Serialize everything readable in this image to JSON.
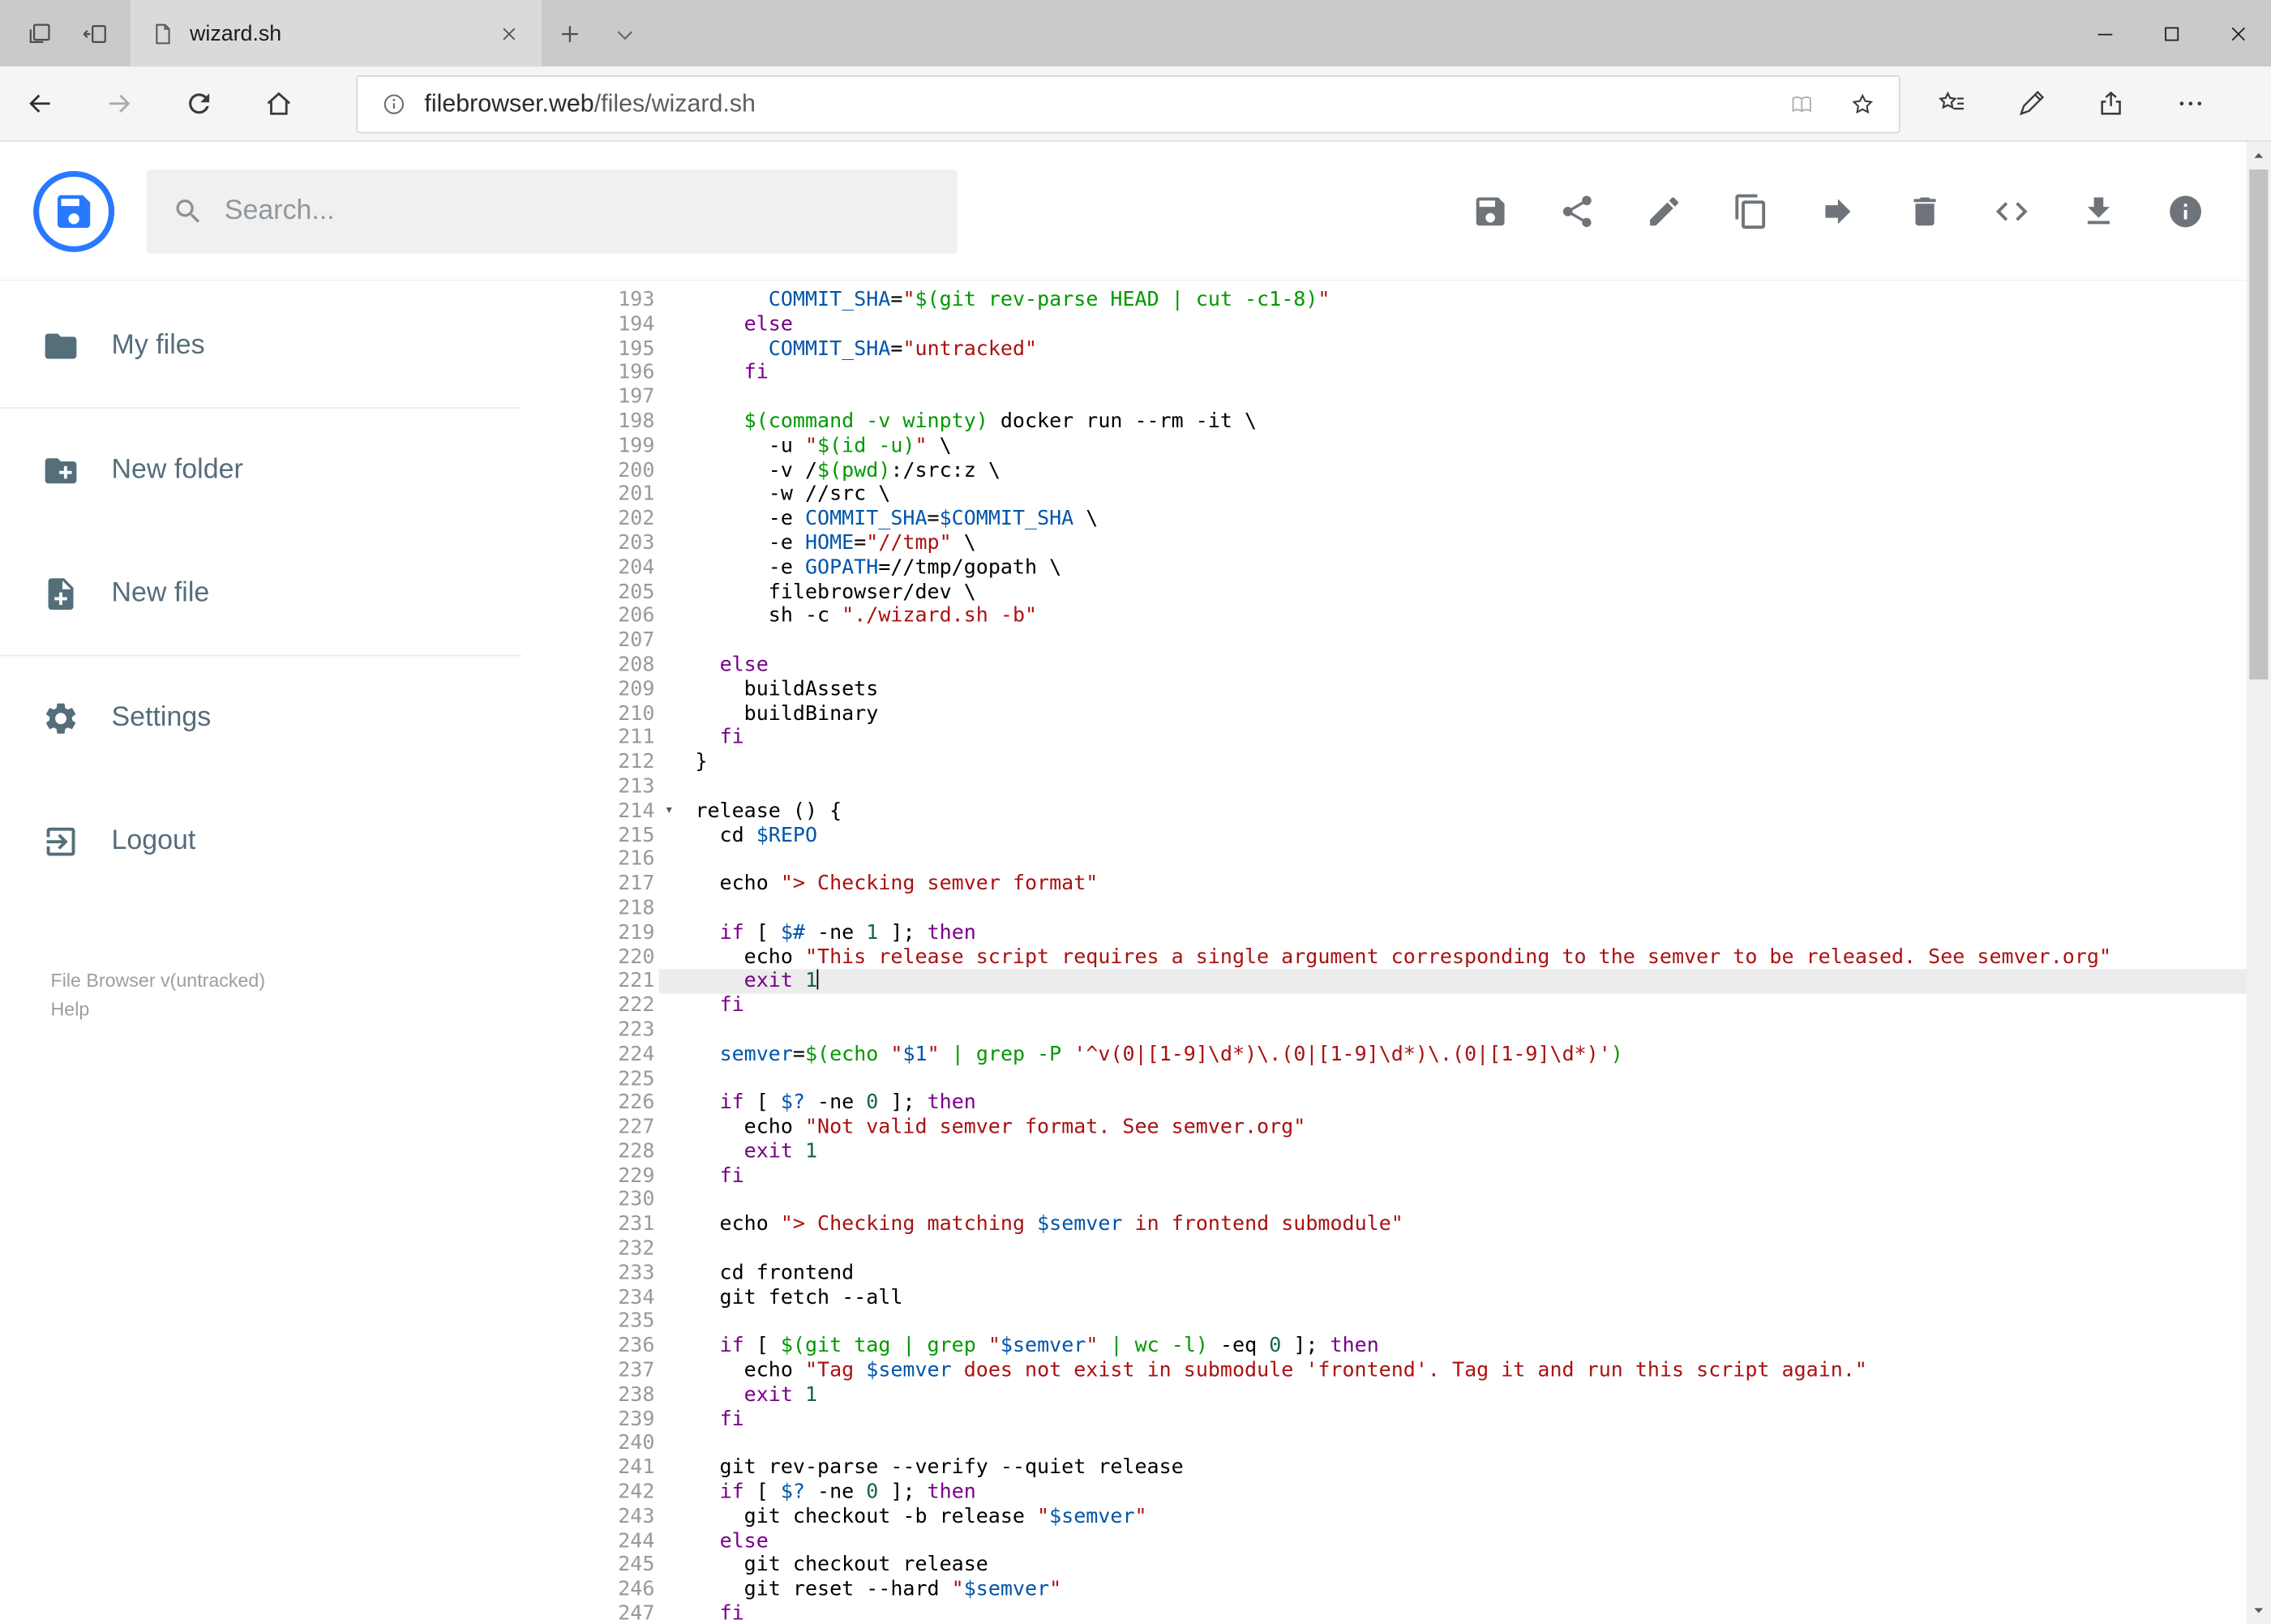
{
  "colors": {
    "brand_blue": "#2979ff",
    "header_icon_gray": "#6e7479",
    "sidebar_gray": "#546e7a"
  },
  "browser": {
    "tab_title": "wizard.sh",
    "url_domain": "filebrowser.web",
    "url_path": "/files/wizard.sh"
  },
  "header": {
    "search_placeholder": "Search..."
  },
  "toolbar": {
    "buttons": [
      {
        "icon": "save",
        "name": "save-button"
      },
      {
        "icon": "share",
        "name": "share-button"
      },
      {
        "icon": "pencil",
        "name": "edit-button"
      },
      {
        "icon": "copy",
        "name": "copy-button"
      },
      {
        "icon": "move",
        "name": "move-button"
      },
      {
        "icon": "trash",
        "name": "delete-button"
      },
      {
        "icon": "code",
        "name": "code-view-button"
      },
      {
        "icon": "download",
        "name": "download-button"
      },
      {
        "icon": "info",
        "name": "info-button"
      }
    ]
  },
  "sidebar": {
    "items": [
      {
        "icon": "folder",
        "label": "My files",
        "divider_after": true
      },
      {
        "icon": "folder-plus",
        "label": "New folder",
        "divider_after": false
      },
      {
        "icon": "file-plus",
        "label": "New file",
        "divider_after": true
      },
      {
        "icon": "gear",
        "label": "Settings",
        "divider_after": false
      },
      {
        "icon": "logout",
        "label": "Logout",
        "divider_after": false
      }
    ],
    "footer": {
      "version": "File Browser v(untracked)",
      "help": "Help"
    }
  },
  "editor": {
    "first_line": 193,
    "active_line": 221,
    "fold_line": 214,
    "colors": {
      "keyword": "#708",
      "string": "#a11",
      "variable": "#05a",
      "quote": "#090",
      "number": "#164",
      "plain": "#000",
      "line_number": "#999",
      "active_line_bg": "#ececec"
    },
    "lines": [
      [
        [
          "p",
          "      "
        ],
        [
          "v",
          "COMMIT_SHA"
        ],
        [
          "p",
          "="
        ],
        [
          "s",
          "\""
        ],
        [
          "q",
          "$(git rev-parse HEAD | cut -c1-8)"
        ],
        [
          "s",
          "\""
        ]
      ],
      [
        [
          "p",
          "    "
        ],
        [
          "k",
          "else"
        ]
      ],
      [
        [
          "p",
          "      "
        ],
        [
          "v",
          "COMMIT_SHA"
        ],
        [
          "p",
          "="
        ],
        [
          "s",
          "\"untracked\""
        ]
      ],
      [
        [
          "p",
          "    "
        ],
        [
          "k",
          "fi"
        ]
      ],
      [],
      [
        [
          "p",
          "    "
        ],
        [
          "q",
          "$(command -v winpty)"
        ],
        [
          "p",
          " docker run --rm -it \\"
        ]
      ],
      [
        [
          "p",
          "      -u "
        ],
        [
          "s",
          "\""
        ],
        [
          "q",
          "$(id -u)"
        ],
        [
          "s",
          "\""
        ],
        [
          "p",
          " \\"
        ]
      ],
      [
        [
          "p",
          "      -v /"
        ],
        [
          "q",
          "$(pwd)"
        ],
        [
          "p",
          ":/src:z \\"
        ]
      ],
      [
        [
          "p",
          "      -w //src \\"
        ]
      ],
      [
        [
          "p",
          "      -e "
        ],
        [
          "v",
          "COMMIT_SHA"
        ],
        [
          "p",
          "="
        ],
        [
          "v",
          "$COMMIT_SHA"
        ],
        [
          "p",
          " \\"
        ]
      ],
      [
        [
          "p",
          "      -e "
        ],
        [
          "v",
          "HOME"
        ],
        [
          "p",
          "="
        ],
        [
          "s",
          "\"//tmp\""
        ],
        [
          "p",
          " \\"
        ]
      ],
      [
        [
          "p",
          "      -e "
        ],
        [
          "v",
          "GOPATH"
        ],
        [
          "p",
          "=//tmp/gopath \\"
        ]
      ],
      [
        [
          "p",
          "      filebrowser/dev \\"
        ]
      ],
      [
        [
          "p",
          "      sh -c "
        ],
        [
          "s",
          "\"./wizard.sh -b\""
        ]
      ],
      [],
      [
        [
          "p",
          "  "
        ],
        [
          "k",
          "else"
        ]
      ],
      [
        [
          "p",
          "    buildAssets"
        ]
      ],
      [
        [
          "p",
          "    buildBinary"
        ]
      ],
      [
        [
          "p",
          "  "
        ],
        [
          "k",
          "fi"
        ]
      ],
      [
        [
          "p",
          "}"
        ]
      ],
      [],
      [
        [
          "p",
          "release () {"
        ]
      ],
      [
        [
          "p",
          "  cd "
        ],
        [
          "v",
          "$REPO"
        ]
      ],
      [],
      [
        [
          "p",
          "  echo "
        ],
        [
          "s",
          "\"> Checking semver format\""
        ]
      ],
      [],
      [
        [
          "p",
          "  "
        ],
        [
          "k",
          "if"
        ],
        [
          "p",
          " [ "
        ],
        [
          "v",
          "$#"
        ],
        [
          "p",
          " -ne "
        ],
        [
          "n",
          "1"
        ],
        [
          "p",
          " ]; "
        ],
        [
          "k",
          "then"
        ]
      ],
      [
        [
          "p",
          "    echo "
        ],
        [
          "s",
          "\"This release script requires a single argument corresponding to the semver to be released. See semver.org\""
        ]
      ],
      [
        [
          "p",
          "    "
        ],
        [
          "k",
          "exit"
        ],
        [
          "p",
          " "
        ],
        [
          "n",
          "1"
        ]
      ],
      [
        [
          "p",
          "  "
        ],
        [
          "k",
          "fi"
        ]
      ],
      [],
      [
        [
          "p",
          "  "
        ],
        [
          "v",
          "semver"
        ],
        [
          "p",
          "="
        ],
        [
          "q",
          "$(echo "
        ],
        [
          "s",
          "\""
        ],
        [
          "v",
          "$1"
        ],
        [
          "s",
          "\""
        ],
        [
          "q",
          " | grep -P "
        ],
        [
          "s",
          "'^v(0|[1-9]\\d*)\\.(0|[1-9]\\d*)\\.(0|[1-9]\\d*)'"
        ],
        [
          "q",
          ")"
        ]
      ],
      [],
      [
        [
          "p",
          "  "
        ],
        [
          "k",
          "if"
        ],
        [
          "p",
          " [ "
        ],
        [
          "v",
          "$?"
        ],
        [
          "p",
          " -ne "
        ],
        [
          "n",
          "0"
        ],
        [
          "p",
          " ]; "
        ],
        [
          "k",
          "then"
        ]
      ],
      [
        [
          "p",
          "    echo "
        ],
        [
          "s",
          "\"Not valid semver format. See semver.org\""
        ]
      ],
      [
        [
          "p",
          "    "
        ],
        [
          "k",
          "exit"
        ],
        [
          "p",
          " "
        ],
        [
          "n",
          "1"
        ]
      ],
      [
        [
          "p",
          "  "
        ],
        [
          "k",
          "fi"
        ]
      ],
      [],
      [
        [
          "p",
          "  echo "
        ],
        [
          "s",
          "\"> Checking matching "
        ],
        [
          "v",
          "$semver"
        ],
        [
          "s",
          " in frontend submodule\""
        ]
      ],
      [],
      [
        [
          "p",
          "  cd frontend"
        ]
      ],
      [
        [
          "p",
          "  git fetch --all"
        ]
      ],
      [],
      [
        [
          "p",
          "  "
        ],
        [
          "k",
          "if"
        ],
        [
          "p",
          " [ "
        ],
        [
          "q",
          "$(git tag | grep "
        ],
        [
          "s",
          "\""
        ],
        [
          "v",
          "$semver"
        ],
        [
          "s",
          "\""
        ],
        [
          "q",
          " | wc -l)"
        ],
        [
          "p",
          " -eq "
        ],
        [
          "n",
          "0"
        ],
        [
          "p",
          " ]; "
        ],
        [
          "k",
          "then"
        ]
      ],
      [
        [
          "p",
          "    echo "
        ],
        [
          "s",
          "\"Tag "
        ],
        [
          "v",
          "$semver"
        ],
        [
          "s",
          " does not exist in submodule 'frontend'. Tag it and run this script again.\""
        ]
      ],
      [
        [
          "p",
          "    "
        ],
        [
          "k",
          "exit"
        ],
        [
          "p",
          " "
        ],
        [
          "n",
          "1"
        ]
      ],
      [
        [
          "p",
          "  "
        ],
        [
          "k",
          "fi"
        ]
      ],
      [],
      [
        [
          "p",
          "  git rev-parse --verify --quiet release"
        ]
      ],
      [
        [
          "p",
          "  "
        ],
        [
          "k",
          "if"
        ],
        [
          "p",
          " [ "
        ],
        [
          "v",
          "$?"
        ],
        [
          "p",
          " -ne "
        ],
        [
          "n",
          "0"
        ],
        [
          "p",
          " ]; "
        ],
        [
          "k",
          "then"
        ]
      ],
      [
        [
          "p",
          "    git checkout -b release "
        ],
        [
          "s",
          "\""
        ],
        [
          "v",
          "$semver"
        ],
        [
          "s",
          "\""
        ]
      ],
      [
        [
          "p",
          "  "
        ],
        [
          "k",
          "else"
        ]
      ],
      [
        [
          "p",
          "    git checkout release"
        ]
      ],
      [
        [
          "p",
          "    git reset --hard "
        ],
        [
          "s",
          "\""
        ],
        [
          "v",
          "$semver"
        ],
        [
          "s",
          "\""
        ]
      ],
      [
        [
          "p",
          "  "
        ],
        [
          "k",
          "fi"
        ]
      ]
    ]
  }
}
